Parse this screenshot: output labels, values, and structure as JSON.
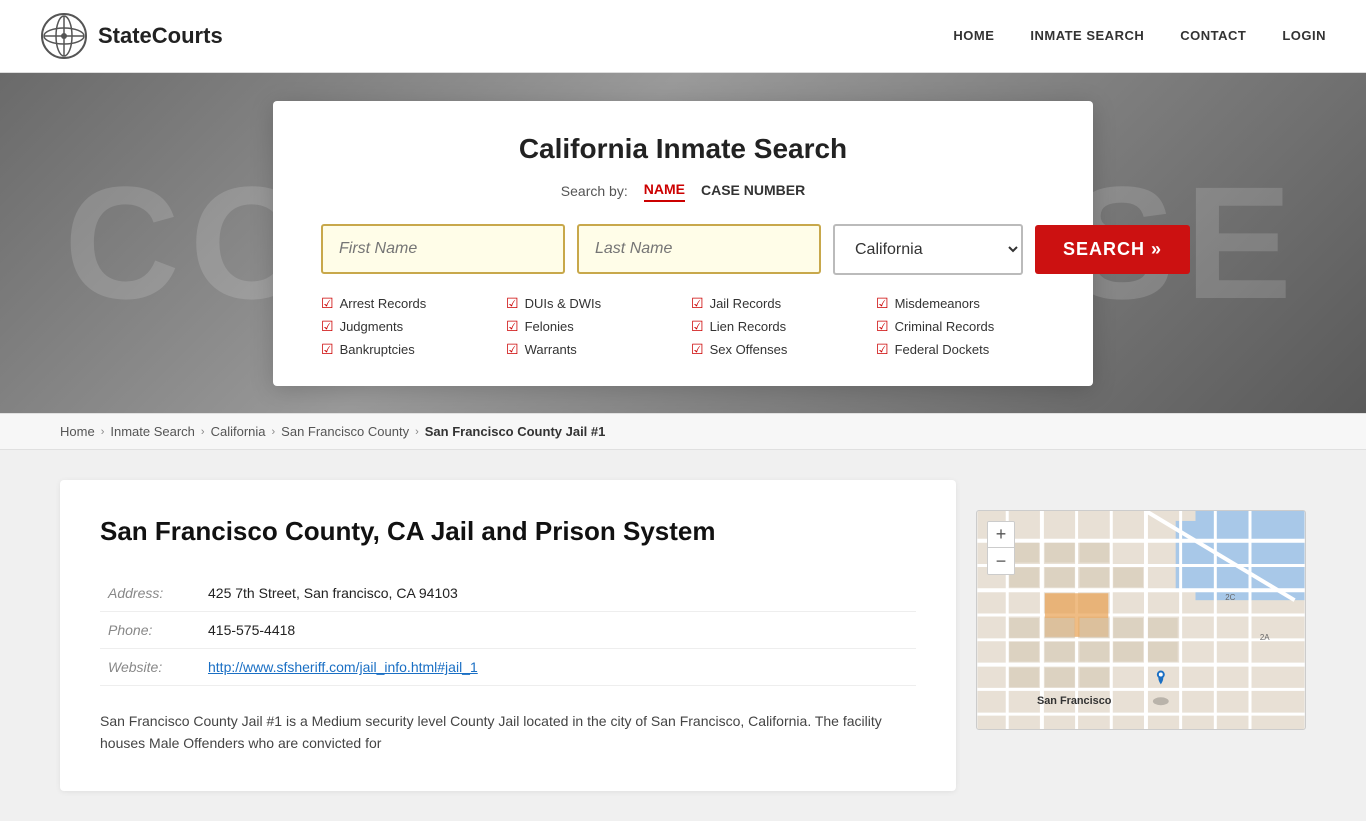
{
  "header": {
    "logo_text": "StateCourts",
    "nav": [
      {
        "label": "HOME",
        "id": "home"
      },
      {
        "label": "INMATE SEARCH",
        "id": "inmate-search"
      },
      {
        "label": "CONTACT",
        "id": "contact"
      },
      {
        "label": "LOGIN",
        "id": "login"
      }
    ]
  },
  "hero_bg_text": "COURTHOUSE",
  "search_card": {
    "title": "California Inmate Search",
    "search_by_label": "Search by:",
    "tabs": [
      {
        "label": "NAME",
        "active": true
      },
      {
        "label": "CASE NUMBER",
        "active": false
      }
    ],
    "first_name_placeholder": "First Name",
    "last_name_placeholder": "Last Name",
    "state_value": "California",
    "search_button_label": "SEARCH »",
    "checkboxes": [
      "Arrest Records",
      "DUIs & DWIs",
      "Jail Records",
      "Misdemeanors",
      "Judgments",
      "Felonies",
      "Lien Records",
      "Criminal Records",
      "Bankruptcies",
      "Warrants",
      "Sex Offenses",
      "Federal Dockets"
    ]
  },
  "breadcrumb": {
    "items": [
      {
        "label": "Home",
        "id": "bc-home"
      },
      {
        "label": "Inmate Search",
        "id": "bc-inmate-search"
      },
      {
        "label": "California",
        "id": "bc-california"
      },
      {
        "label": "San Francisco County",
        "id": "bc-sf-county"
      },
      {
        "label": "San Francisco County Jail #1",
        "id": "bc-sf-jail",
        "current": true
      }
    ]
  },
  "main": {
    "jail_title": "San Francisco County, CA Jail and Prison System",
    "address_label": "Address:",
    "address_value": "425 7th Street, San francisco, CA 94103",
    "phone_label": "Phone:",
    "phone_value": "415-575-4418",
    "website_label": "Website:",
    "website_url": "http://www.sfsheriff.com/jail_info.html#jail_1",
    "website_text": "http://www.sfsheriff.com/jail_info.html#jail_1",
    "description": "San Francisco County Jail #1 is a Medium security level County Jail located in the city of San Francisco, California. The facility houses Male Offenders who are convicted for",
    "map_zoom_in": "+",
    "map_zoom_out": "−"
  }
}
